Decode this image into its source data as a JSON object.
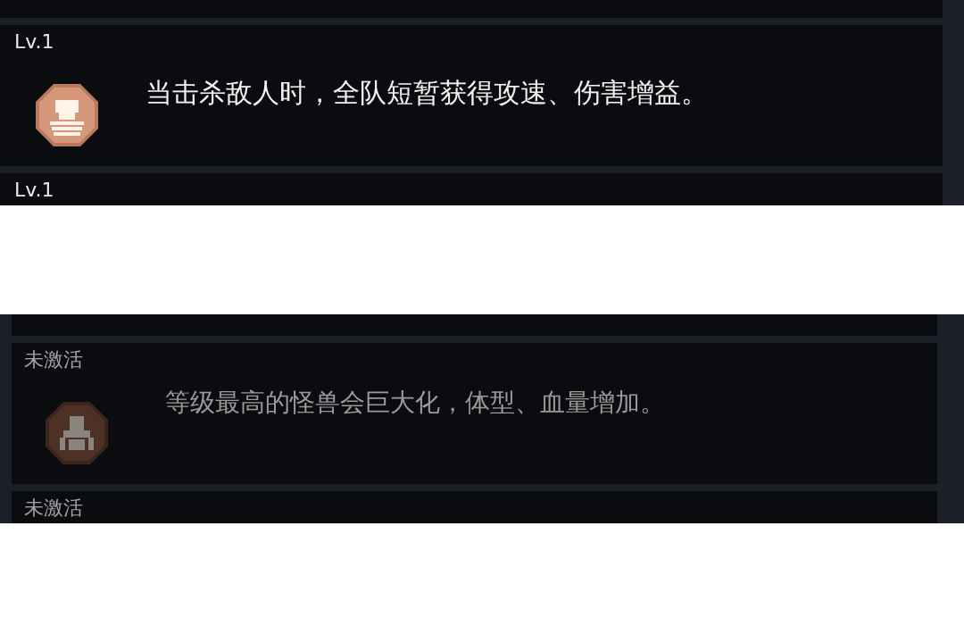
{
  "panels": [
    {
      "active": true,
      "cards": [
        {
          "status": "Lv.1",
          "description": "当击杀敌人时，全队短暂获得攻速、伤害增益。"
        },
        {
          "status": "Lv.1"
        }
      ]
    },
    {
      "active": false,
      "cards": [
        {
          "status": "未激活",
          "description": "等级最高的怪兽会巨大化，体型、血量增加。"
        },
        {
          "status": "未激活"
        }
      ]
    }
  ]
}
